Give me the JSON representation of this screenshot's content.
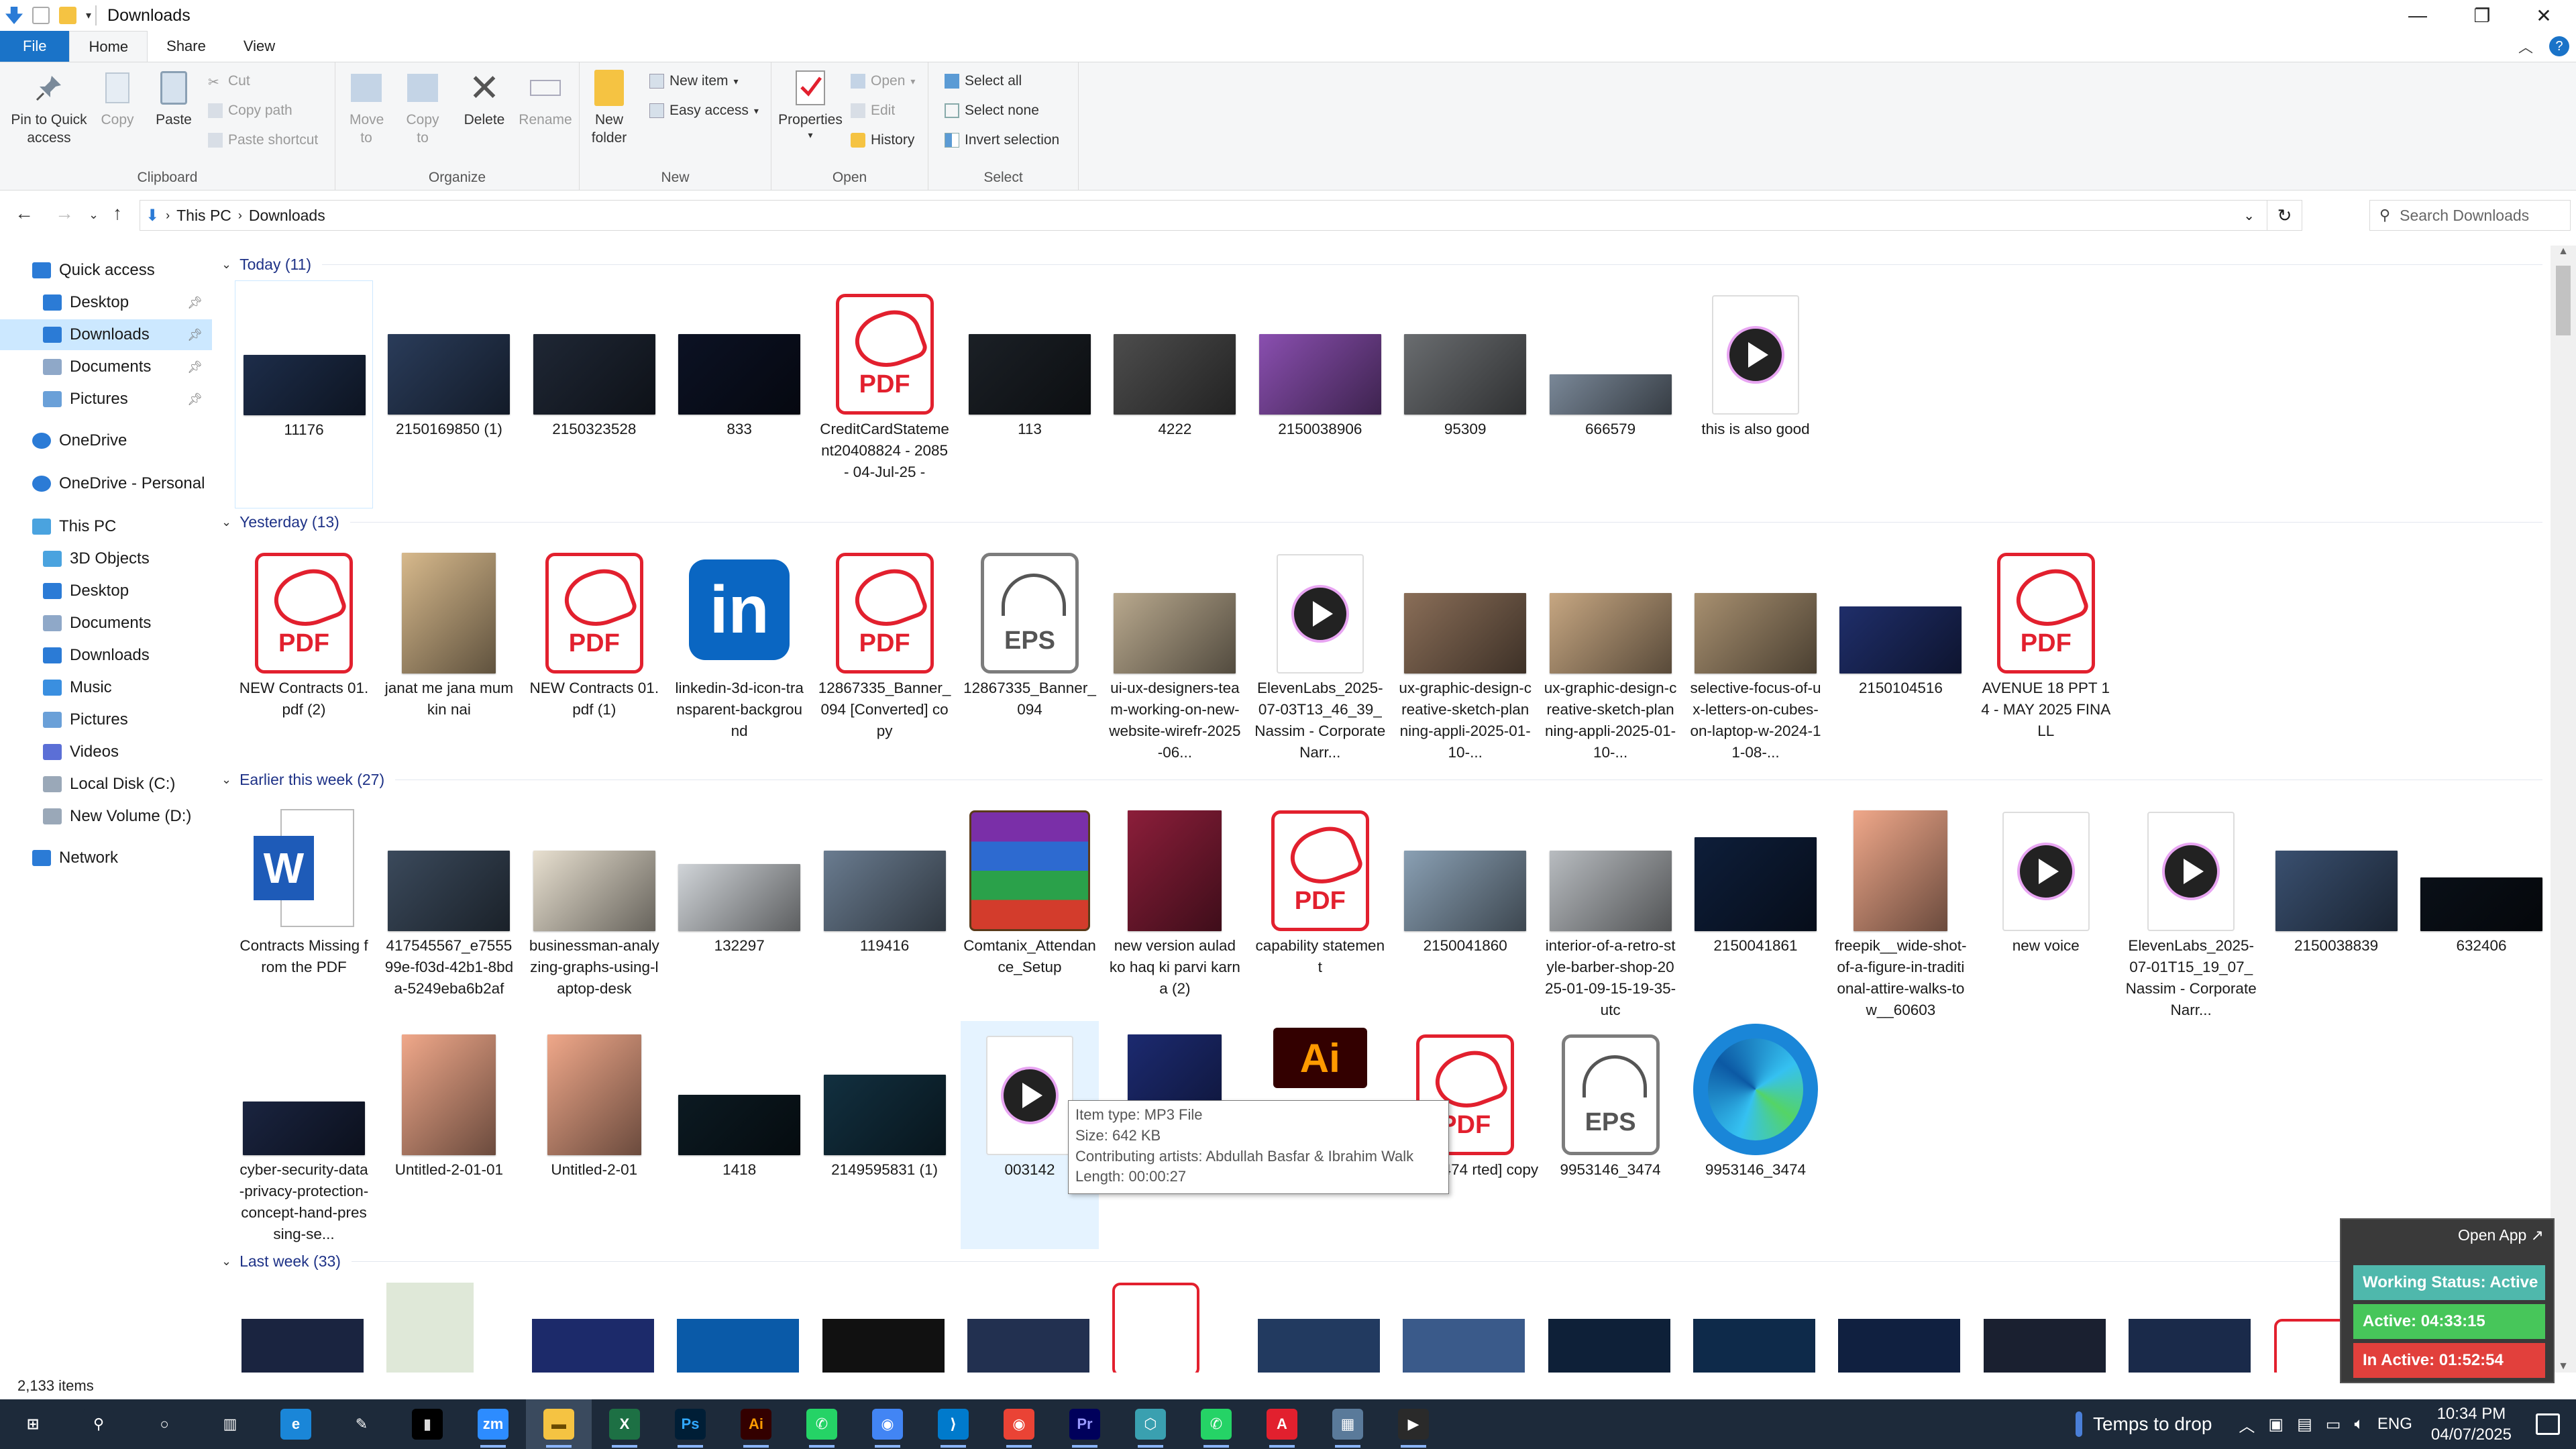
{
  "window": {
    "title": "Downloads",
    "help": "?"
  },
  "ribbon": {
    "tabs": [
      "File",
      "Home",
      "Share",
      "View"
    ],
    "clipboard": {
      "pin": "Pin to Quick access",
      "copy": "Copy",
      "paste": "Paste",
      "cut": "Cut",
      "copy_path": "Copy path",
      "paste_shortcut": "Paste shortcut",
      "label": "Clipboard"
    },
    "organize": {
      "move_to": "Move to",
      "copy_to": "Copy to",
      "delete": "Delete",
      "rename": "Rename",
      "label": "Organize"
    },
    "new": {
      "new_folder": "New folder",
      "new_item": "New item",
      "easy_access": "Easy access",
      "label": "New"
    },
    "open": {
      "properties": "Properties",
      "open": "Open",
      "edit": "Edit",
      "history": "History",
      "label": "Open"
    },
    "select": {
      "select_all": "Select all",
      "select_none": "Select none",
      "invert": "Invert selection",
      "label": "Select"
    }
  },
  "address": {
    "crumbs": [
      "This PC",
      "Downloads"
    ],
    "search_placeholder": "Search Downloads"
  },
  "nav": {
    "quick_access": "Quick access",
    "quick": [
      {
        "label": "Desktop",
        "color": "#2b7bd6"
      },
      {
        "label": "Downloads",
        "color": "#2b7bd6"
      },
      {
        "label": "Documents",
        "color": "#8fa8c8"
      },
      {
        "label": "Pictures",
        "color": "#6aa0d8"
      }
    ],
    "onedrive": "OneDrive",
    "onedrive_personal": "OneDrive - Personal",
    "this_pc": "This PC",
    "pc": [
      {
        "label": "3D Objects",
        "color": "#4aa3df"
      },
      {
        "label": "Desktop",
        "color": "#2b7bd6"
      },
      {
        "label": "Documents",
        "color": "#8fa8c8"
      },
      {
        "label": "Downloads",
        "color": "#2b7bd6"
      },
      {
        "label": "Music",
        "color": "#3a8fe0"
      },
      {
        "label": "Pictures",
        "color": "#6aa0d8"
      },
      {
        "label": "Videos",
        "color": "#5b6fd6"
      },
      {
        "label": "Local Disk (C:)",
        "color": "#9aa8b8"
      },
      {
        "label": "New Volume (D:)",
        "color": "#9aa8b8"
      }
    ],
    "network": "Network"
  },
  "groups": [
    {
      "header": "Today (11)",
      "items": [
        {
          "name": "11176",
          "kind": "photo",
          "h": 90,
          "c": "#1d2d4a"
        },
        {
          "name": "2150169850 (1)",
          "kind": "photo",
          "h": 120,
          "c": "#2a3c5a"
        },
        {
          "name": "2150323528",
          "kind": "photo",
          "h": 120,
          "c": "#1f2735"
        },
        {
          "name": "833",
          "kind": "photo",
          "h": 120,
          "c": "#0c1224"
        },
        {
          "name": "CreditCardStatement20408824 - 2085 - 04-Jul-25 -",
          "kind": "pdf"
        },
        {
          "name": "113",
          "kind": "photo",
          "h": 120,
          "c": "#1b2026"
        },
        {
          "name": "4222",
          "kind": "photo",
          "h": 120,
          "c": "#4d4d4d"
        },
        {
          "name": "2150038906",
          "kind": "photo",
          "h": 120,
          "c": "#8a4fb0"
        },
        {
          "name": "95309",
          "kind": "photo",
          "h": 120,
          "c": "#6a6d70"
        },
        {
          "name": "666579",
          "kind": "photo",
          "h": 60,
          "c": "#7a8898"
        },
        {
          "name": "this is also good",
          "kind": "media"
        }
      ]
    },
    {
      "header": "Yesterday (13)",
      "items": [
        {
          "name": "NEW Contracts 01.pdf (2)",
          "kind": "pdf"
        },
        {
          "name": "janat me jana mumkin nai",
          "kind": "photo",
          "h": 180,
          "c": "#d7b98c",
          "narrow": true
        },
        {
          "name": "NEW Contracts 01.pdf (1)",
          "kind": "pdf"
        },
        {
          "name": "linkedin-3d-icon-transparent-background",
          "kind": "linkedin"
        },
        {
          "name": "12867335_Banner_094 [Converted] copy",
          "kind": "pdf"
        },
        {
          "name": "12867335_Banner_094",
          "kind": "eps"
        },
        {
          "name": "ui-ux-designers-team-working-on-new-website-wirefr-2025-06...",
          "kind": "photo",
          "h": 120,
          "c": "#b9a98e"
        },
        {
          "name": "ElevenLabs_2025-07-03T13_46_39_Nassim - Corporate Narr...",
          "kind": "media"
        },
        {
          "name": "ux-graphic-design-creative-sketch-planning-appli-2025-01-10-...",
          "kind": "photo",
          "h": 120,
          "c": "#8a6e58"
        },
        {
          "name": "ux-graphic-design-creative-sketch-planning-appli-2025-01-10-...",
          "kind": "photo",
          "h": 120,
          "c": "#c7a782"
        },
        {
          "name": "selective-focus-of-ux-letters-on-cubes-on-laptop-w-2024-11-08-...",
          "kind": "photo",
          "h": 120,
          "c": "#a89070"
        },
        {
          "name": "2150104516",
          "kind": "photo",
          "h": 100,
          "c": "#1f2e6a"
        },
        {
          "name": "AVENUE 18 PPT 14 - MAY 2025 FINALL",
          "kind": "pdf"
        }
      ]
    },
    {
      "header": "Earlier this week (27)",
      "items": [
        {
          "name": "Contracts Missing from the PDF",
          "kind": "word"
        },
        {
          "name": "417545567_e755599e-f03d-42b1-8bda-5249eba6b2af",
          "kind": "photo",
          "h": 120,
          "c": "#3b4a5c"
        },
        {
          "name": "businessman-analyzing-graphs-using-laptop-desk",
          "kind": "photo",
          "h": 120,
          "c": "#e8e0d0"
        },
        {
          "name": "132297",
          "kind": "photo",
          "h": 100,
          "c": "#d0d4d8"
        },
        {
          "name": "119416",
          "kind": "photo",
          "h": 120,
          "c": "#6a7c90"
        },
        {
          "name": "Comtanix_Attendance_Setup",
          "kind": "winrar"
        },
        {
          "name": "new version aulad ko haq ki parvi karna (2)",
          "kind": "photo",
          "h": 180,
          "c": "#8c1e3a",
          "narrow": true
        },
        {
          "name": "capability statement",
          "kind": "pdf"
        },
        {
          "name": "2150041860",
          "kind": "photo",
          "h": 120,
          "c": "#8aa0b4"
        },
        {
          "name": "interior-of-a-retro-style-barber-shop-2025-01-09-15-19-35-utc",
          "kind": "photo",
          "h": 120,
          "c": "#b8bcc0"
        },
        {
          "name": "2150041861",
          "kind": "photo",
          "h": 140,
          "c": "#0e1e3a"
        },
        {
          "name": "freepik__wide-shot-of-a-figure-in-traditional-attire-walks-tow__60603",
          "kind": "photo",
          "h": 180,
          "c": "#f0a88a",
          "narrow": true
        },
        {
          "name": "new voice",
          "kind": "media"
        },
        {
          "name": "ElevenLabs_2025-07-01T15_19_07_Nassim - Corporate Narr...",
          "kind": "media"
        },
        {
          "name": "2150038839",
          "kind": "photo",
          "h": 120,
          "c": "#3a5070"
        },
        {
          "name": "632406",
          "kind": "photo",
          "h": 80,
          "c": "#0a1018"
        }
      ]
    },
    {
      "header": "",
      "items": [
        {
          "name": "cyber-security-data-privacy-protection-concept-hand-pressing-se...",
          "kind": "photo",
          "h": 80,
          "c": "#1a2440"
        },
        {
          "name": "Untitled-2-01-01",
          "kind": "photo",
          "h": 180,
          "c": "#f0a88a",
          "narrow": true
        },
        {
          "name": "Untitled-2-01",
          "kind": "photo",
          "h": 180,
          "c": "#f0a88a",
          "narrow": true
        },
        {
          "name": "1418",
          "kind": "photo",
          "h": 90,
          "c": "#0c1a22"
        },
        {
          "name": "2149595831 (1)",
          "kind": "photo",
          "h": 120,
          "c": "#123040"
        },
        {
          "name": "003142",
          "kind": "media"
        },
        {
          "name": "",
          "kind": "photo",
          "h": 180,
          "c": "#1c2a70",
          "narrow": true
        },
        {
          "name": "",
          "kind": "ai"
        },
        {
          "name": "12867335_Banner_094 [Converted] copy",
          "kind": "pdf",
          "shown": "146_3474 rted] copy"
        },
        {
          "name": "9953146_3474",
          "kind": "eps"
        },
        {
          "name": "9953146_3474",
          "kind": "edge"
        }
      ]
    },
    {
      "header": "Last week (33)",
      "items": []
    }
  ],
  "tooltip": {
    "lines": [
      "Item type: MP3 File",
      "Size: 642 KB",
      "Contributing artists: Abdullah Basfar & Ibrahim Walk",
      "Length: 00:00:27"
    ]
  },
  "status": {
    "count": "2,133 items"
  },
  "widget": {
    "open_app": "Open App ↗",
    "working": "Working Status: Active",
    "active": "Active: 04:33:15",
    "inactive": "In Active: 01:52:54"
  },
  "taskbar": {
    "apps": [
      "start",
      "search",
      "cortana",
      "task-view",
      "edge",
      "pen",
      "terminal",
      "zoom",
      "explorer",
      "excel",
      "photoshop",
      "illustrator",
      "whatsapp",
      "chrome",
      "vscode",
      "chrome-profile",
      "premiere",
      "app-hex",
      "whatsapp-2",
      "acrobat",
      "calculator",
      "media-player"
    ],
    "drop": "Temps to drop",
    "lang": "ENG",
    "time": "10:34 PM",
    "date": "04/07/2025"
  },
  "colors": {
    "accent": "#1a73c8",
    "selection": "#cce8ff",
    "widget_green": "#47c65a",
    "widget_red": "#e2403c",
    "widget_teal": "#4fb8ac"
  }
}
